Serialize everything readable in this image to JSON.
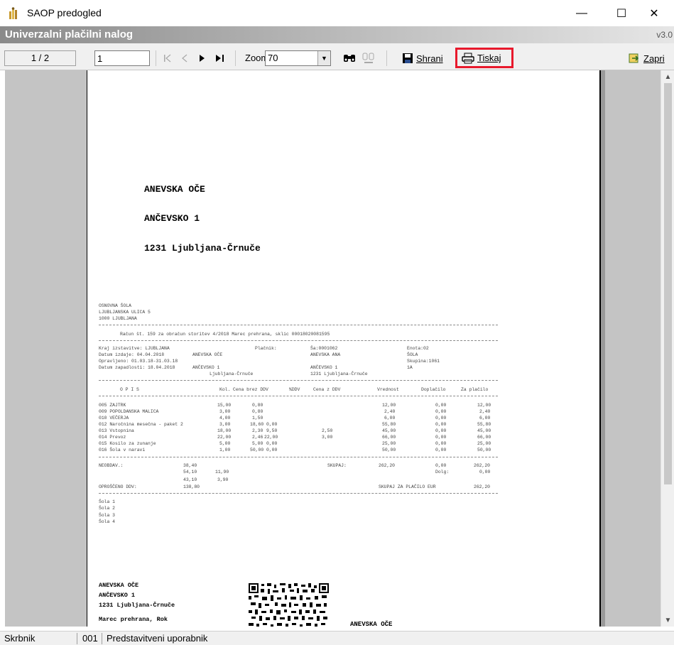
{
  "window": {
    "title": "SAOP predogled",
    "minimize": "—",
    "maximize": "☐",
    "close": "✕"
  },
  "header": {
    "title": "Univerzalni plačilni nalog",
    "version": "v3.0"
  },
  "toolbar": {
    "page_indicator": "1 / 2",
    "page_input": "1",
    "zoom_label": "Zoom:",
    "zoom_value": "70",
    "save_label": "Shrani",
    "print_label": "Tiskaj",
    "close_label": "Zapri",
    "icons": {
      "first": "first-page-icon",
      "prev": "prev-page-icon",
      "next": "next-page-icon",
      "last": "last-page-icon",
      "find": "binoculars-icon",
      "find_next": "find-next-icon",
      "save": "floppy-icon",
      "print": "printer-icon",
      "close": "book-exit-icon"
    },
    "highlight_color": "#e8192c"
  },
  "document": {
    "recipient": {
      "name": "ANEVSKA OČE",
      "street": "ANČEVSKO 1",
      "city": "1231 Ljubljana-Črnuče"
    },
    "issuer": {
      "line1": "OSNOVNA ŠOLA",
      "line2": "LJUBLJANSKA ULICA 5",
      "line3": "1000 LJUBLJANA"
    },
    "invoice_title": "Račun št. 159 za obračun storitev 4/2018  Marec prehrana, sklic 00018020081595",
    "info": {
      "place_label": "Kraj izstavitve: LJUBLJANA",
      "payer_label": "Plačnik:",
      "id_label": "Ša:0001062",
      "class_label": "Enota:02",
      "issue_date": "Datum izdaje:     04.04.2018",
      "payer_name": "ANEVSKA OČE",
      "pupil_name": "ANEVSKA ANA",
      "school_label": "ŠOLA",
      "service_period": "Opravljeno:  01.03.18-31.03.18",
      "group_label": "Skupina:1061",
      "due_date": "Datum zapadlosti:   18.04.2018",
      "payer_street": "ANČEVSKO 1",
      "pupil_street": "ANČEVSKO 1",
      "grade_label": "1A",
      "payer_city": "Ljubljana-Črnuče",
      "pupil_city": "1231 Ljubljana-Črnuče"
    },
    "columns": [
      "O P I S",
      "Kol.",
      "Cena brez DDV",
      "%DDV",
      "Cena z DDV",
      "Vrednost",
      "Doplačilo",
      "Za plačilo"
    ],
    "rows": [
      {
        "desc": "005 ZAJTRK",
        "qty": "15,00",
        "price": "0,80",
        "vat": "",
        "gross": "",
        "value": "12,00",
        "extra": "0,00",
        "pay": "12,00"
      },
      {
        "desc": "009 POPOLDANSKA MALICA",
        "qty": "3,00",
        "price": "0,80",
        "vat": "",
        "gross": "",
        "value": "2,40",
        "extra": "0,00",
        "pay": "2,40"
      },
      {
        "desc": "010 VEČERJA",
        "qty": "4,00",
        "price": "1,50",
        "vat": "",
        "gross": "",
        "value": "6,00",
        "extra": "0,00",
        "pay": "6,00"
      },
      {
        "desc": "012 Naročnina mesečna - paket 2",
        "qty": "3,00",
        "price": "18,60",
        "vat": "0,00",
        "gross": "",
        "value": "55,80",
        "extra": "0,00",
        "pay": "55,80"
      },
      {
        "desc": "013 Vstopnina",
        "qty": "18,00",
        "price": "2,30",
        "vat": "9,50",
        "gross": "2,50",
        "value": "45,00",
        "extra": "0,00",
        "pay": "45,00"
      },
      {
        "desc": "014 Prevoz",
        "qty": "22,00",
        "price": "2,46",
        "vat": "22,00",
        "gross": "3,00",
        "value": "66,00",
        "extra": "0,00",
        "pay": "66,00"
      },
      {
        "desc": "015 Kosilo za zunanje",
        "qty": "5,00",
        "price": "5,00",
        "vat": "0,00",
        "gross": "",
        "value": "25,00",
        "extra": "0,00",
        "pay": "25,00"
      },
      {
        "desc": "016 Šola v naravi",
        "qty": "1,00",
        "price": "50,00",
        "vat": "0,00",
        "gross": "",
        "value": "50,00",
        "extra": "0,00",
        "pay": "50,00"
      }
    ],
    "totals": {
      "untaxed_label": "NEOBDAV.:",
      "untaxed_1": "38,40",
      "untaxed_2": "54,10",
      "untaxed_2b": "11,90",
      "untaxed_3": "43,10",
      "untaxed_3b": "3,90",
      "exempt_label": "OPROŠČENO DDV:",
      "exempt_value": "138,80",
      "sum_label": "SKUPAJ:",
      "sum_value": "262,20",
      "sum_extra": "0,00",
      "sum_pay": "262,20",
      "debt_label": "Dolg:",
      "debt_value": "0,00",
      "due_label": "SKUPAJ ZA PLAČILO EUR",
      "due_value": "262,20"
    },
    "notes": [
      "Šola 1",
      "Šola 2",
      "Šola 3",
      "Šola 4"
    ],
    "footer": {
      "name": "ANEVSKA OČE",
      "street": "ANČEVSKO 1",
      "city": "1231 Ljubljana-Črnuče",
      "purpose": "Marec prehrana, Rok",
      "recipient_right": "ANEVSKA OČE"
    }
  },
  "statusbar": {
    "role": "Skrbnik",
    "code": "001",
    "user": "Predstavitveni uporabnik"
  }
}
